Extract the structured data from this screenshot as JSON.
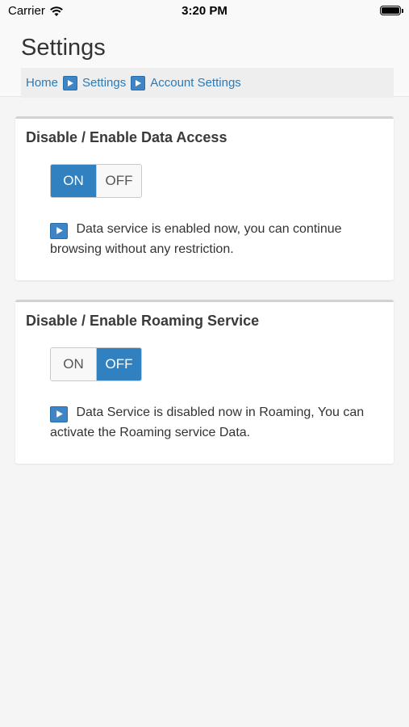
{
  "status_bar": {
    "carrier": "Carrier",
    "time": "3:20 PM"
  },
  "header": {
    "title": "Settings",
    "breadcrumb": [
      "Home",
      "Settings",
      "Account Settings"
    ]
  },
  "panels": [
    {
      "title": "Disable / Enable Data Access",
      "on_label": "ON",
      "off_label": "OFF",
      "state": "ON",
      "message": "Data service is enabled now, you can continue browsing without any restriction."
    },
    {
      "title": "Disable / Enable Roaming Service",
      "on_label": "ON",
      "off_label": "OFF",
      "state": "OFF",
      "message": "Data Service is disabled now in Roaming, You can activate the Roaming service Data."
    }
  ],
  "colors": {
    "accent": "#3181c0",
    "link": "#2a7ab8"
  },
  "icons": {
    "breadcrumb_separator": "play-arrow-icon",
    "note": "play-arrow-icon"
  }
}
